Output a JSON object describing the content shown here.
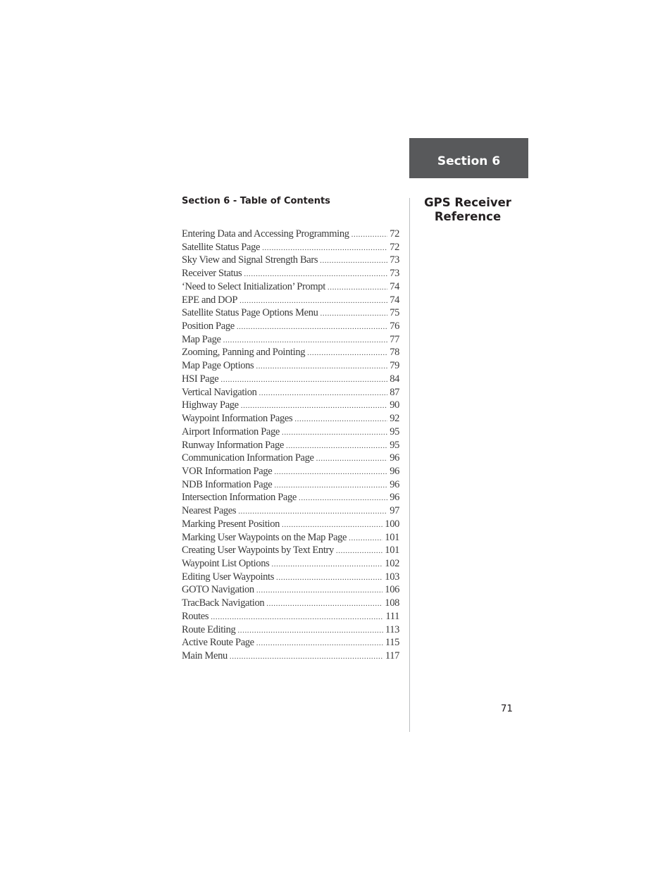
{
  "section_tab": {
    "label": "Section 6"
  },
  "side_title": {
    "line1": "GPS Receiver",
    "line2": "Reference"
  },
  "toc": {
    "heading": "Section 6 - Table of Contents",
    "entries": [
      {
        "title": "Entering Data and Accessing Programming",
        "page": "72"
      },
      {
        "title": "Satellite Status Page",
        "page": "72"
      },
      {
        "title": "Sky View and Signal Strength Bars",
        "page": "73"
      },
      {
        "title": "Receiver Status",
        "page": "73"
      },
      {
        "title": "‘Need to Select Initialization’ Prompt",
        "page": "74"
      },
      {
        "title": "EPE and DOP",
        "page": "74"
      },
      {
        "title": "Satellite Status Page Options Menu",
        "page": "75"
      },
      {
        "title": "Position Page",
        "page": "76"
      },
      {
        "title": "Map Page",
        "page": "77"
      },
      {
        "title": "Zooming, Panning and Pointing",
        "page": "78"
      },
      {
        "title": "Map Page Options",
        "page": "79"
      },
      {
        "title": "HSI Page",
        "page": "84"
      },
      {
        "title": "Vertical Navigation",
        "page": "87"
      },
      {
        "title": "Highway Page",
        "page": "90"
      },
      {
        "title": "Waypoint Information Pages",
        "page": "92"
      },
      {
        "title": "Airport Information Page",
        "page": "95"
      },
      {
        "title": "Runway Information Page",
        "page": "95"
      },
      {
        "title": "Communication Information Page",
        "page": "96"
      },
      {
        "title": "VOR Information Page",
        "page": "96"
      },
      {
        "title": "NDB Information Page",
        "page": "96"
      },
      {
        "title": "Intersection Information Page",
        "page": "96"
      },
      {
        "title": "Nearest Pages",
        "page": "97"
      },
      {
        "title": "Marking Present Position",
        "page": "100"
      },
      {
        "title": "Marking User Waypoints on the Map Page",
        "page": "101"
      },
      {
        "title": "Creating User Waypoints by Text Entry",
        "page": "101"
      },
      {
        "title": "Waypoint List Options",
        "page": "102"
      },
      {
        "title": "Editing User Waypoints",
        "page": "103"
      },
      {
        "title": "GOTO Navigation",
        "page": "106"
      },
      {
        "title": "TracBack Navigation",
        "page": "108"
      },
      {
        "title": "Routes",
        "page": "111"
      },
      {
        "title": "Route Editing",
        "page": "113"
      },
      {
        "title": "Active Route Page",
        "page": "115"
      },
      {
        "title": "Main Menu",
        "page": "117"
      }
    ]
  },
  "footer": {
    "page_number": "71"
  },
  "colors": {
    "tab_background": "#58595b",
    "tab_text": "#ffffff",
    "rule": "#bcbec0",
    "text": "#231f20"
  }
}
